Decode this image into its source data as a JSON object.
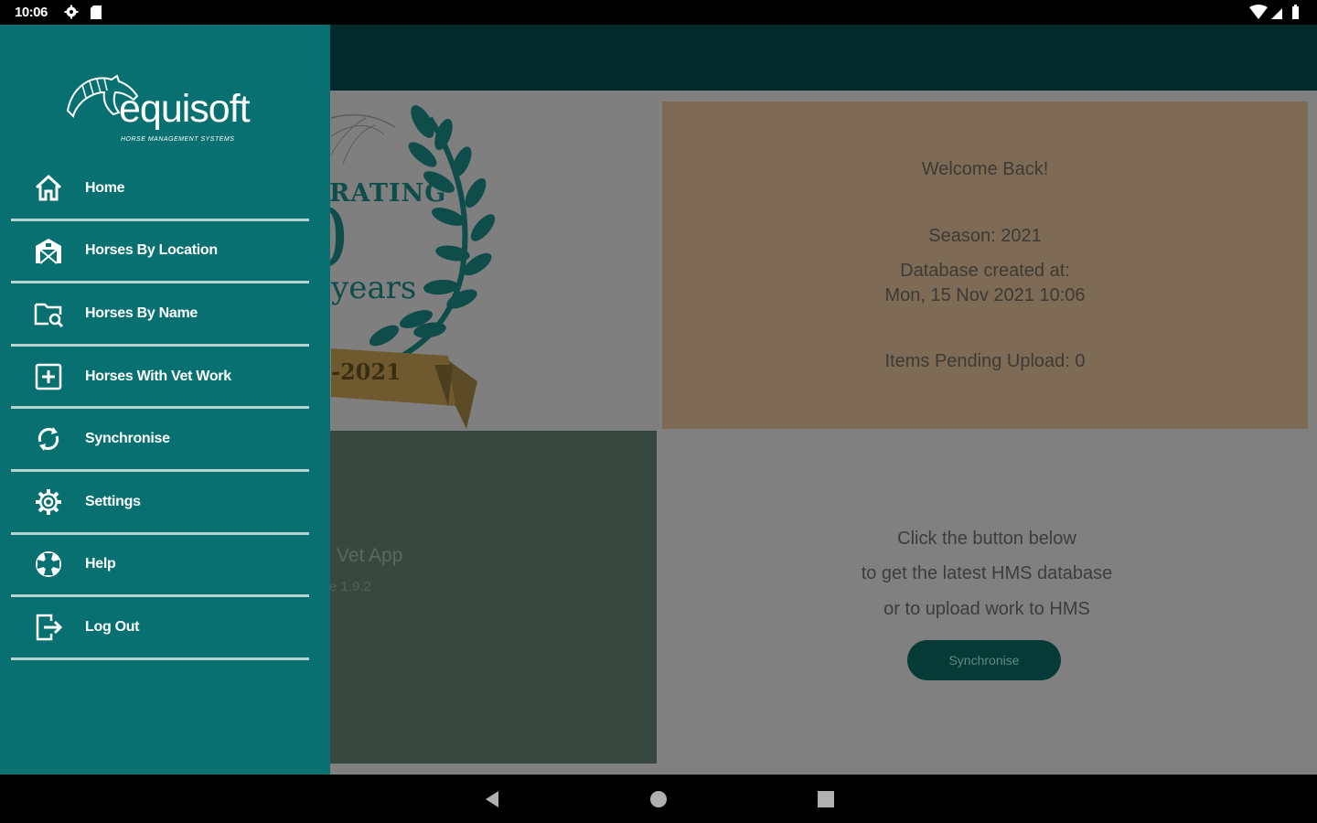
{
  "status_bar": {
    "time": "10:06"
  },
  "drawer": {
    "brand": {
      "name": "equisoft",
      "tagline": "HORSE MANAGEMENT SYSTEMS"
    },
    "items": [
      {
        "label": "Home",
        "icon": "home-icon"
      },
      {
        "label": "Horses By Location",
        "icon": "barn-icon"
      },
      {
        "label": "Horses By Name",
        "icon": "folder-search-icon"
      },
      {
        "label": "Horses With Vet Work",
        "icon": "plus-box-icon"
      },
      {
        "label": "Synchronise",
        "icon": "sync-icon"
      },
      {
        "label": "Settings",
        "icon": "gear-icon"
      },
      {
        "label": "Help",
        "icon": "lifebuoy-icon"
      },
      {
        "label": "Log Out",
        "icon": "logout-icon"
      }
    ]
  },
  "celebration": {
    "text_top": "RATING",
    "number": "0",
    "years": "years",
    "ribbon": "-2021"
  },
  "welcome": {
    "greeting": "Welcome Back!",
    "season": "Season: 2021",
    "db_created_label": "Database created at:",
    "db_created_value": "Mon, 15 Nov 2021 10:06",
    "pending": "Items Pending Upload: 0"
  },
  "app_info": {
    "name": "Vet App",
    "version": "e 1.9.2"
  },
  "sync": {
    "line1": "Click the button below",
    "line2": "to get the latest HMS database",
    "line3": "or to upload work to HMS",
    "button": "Synchronise"
  },
  "colors": {
    "drawer": "#087070",
    "app_bar": "#03292a",
    "welcome_tile": "#7d6b55",
    "app_tile": "#374840",
    "sync_button": "#053a37"
  }
}
